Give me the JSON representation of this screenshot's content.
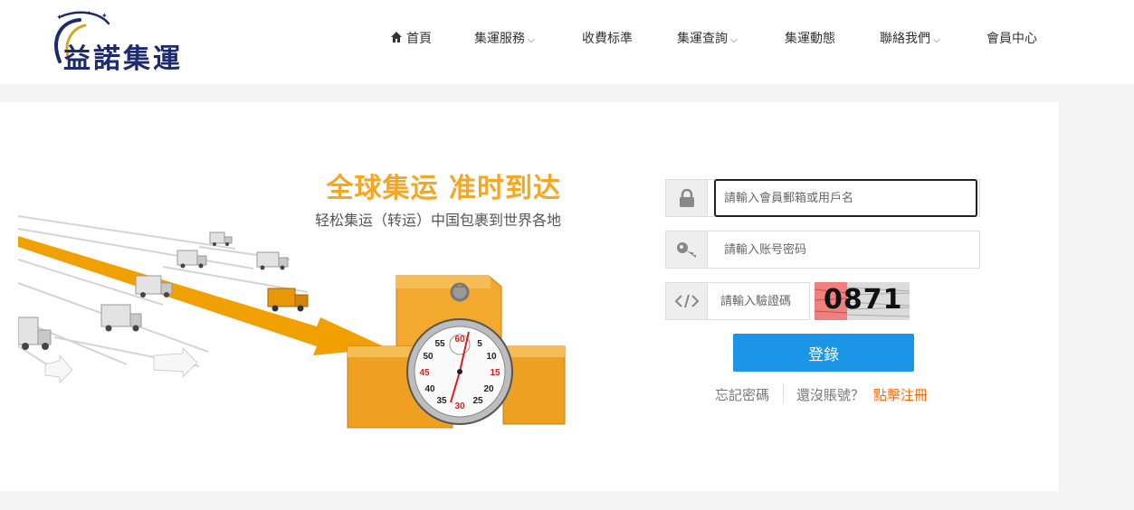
{
  "brand": {
    "logo_text": "益諾集運"
  },
  "nav": {
    "home": "首頁",
    "services": "集運服務",
    "fees": "收費标準",
    "tracking": "集運查詢",
    "news": "集運動態",
    "contact": "聯絡我們",
    "member": "會員中心"
  },
  "hero": {
    "title": "全球集运  准时到达",
    "subtitle": "轻松集运（转运）中国包裹到世界各地"
  },
  "stopwatch": {
    "numbers": [
      "60",
      "5",
      "10",
      "15",
      "20",
      "25",
      "30",
      "35",
      "40",
      "45",
      "50",
      "55"
    ]
  },
  "form": {
    "username_placeholder": "請輸入會員郵箱或用戶名",
    "password_placeholder": "請輸入账号密码",
    "captcha_placeholder": "請輸入驗證碼",
    "captcha_code": "0871",
    "login_label": "登錄",
    "forgot_label": "忘記密碼",
    "no_account_label": "還沒賬號？",
    "register_label": "點擊注冊"
  },
  "colors": {
    "accent_orange": "#f5a623",
    "button_blue": "#1a95e8",
    "link_orange": "#ff6a00",
    "logo_navy": "#1e2a6e"
  },
  "icons": {
    "home": "home-icon",
    "dropdown": "chevron-down-icon",
    "username": "lock-icon",
    "password": "key-icon",
    "captcha": "code-icon"
  }
}
